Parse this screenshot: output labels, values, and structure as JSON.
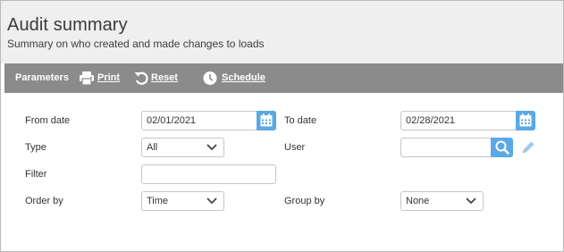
{
  "header": {
    "title": "Audit summary",
    "subtitle": "Summary on who created and made changes to loads"
  },
  "toolbar": {
    "label": "Parameters",
    "print": "Print",
    "reset": "Reset",
    "schedule": "Schedule"
  },
  "form": {
    "from_date": {
      "label": "From date",
      "value": "02/01/2021"
    },
    "to_date": {
      "label": "To date",
      "value": "02/28/2021"
    },
    "type": {
      "label": "Type",
      "value": "All"
    },
    "user": {
      "label": "User",
      "value": ""
    },
    "filter": {
      "label": "Filter",
      "value": ""
    },
    "order_by": {
      "label": "Order by",
      "value": "Time"
    },
    "group_by": {
      "label": "Group by",
      "value": "None"
    }
  },
  "colors": {
    "toolbar_bg": "#8b8b8b",
    "accent": "#5aa9e6",
    "header_bg": "#efefef"
  },
  "icons": [
    "printer-icon",
    "reset-icon",
    "clock-icon",
    "calendar-icon",
    "search-icon",
    "pencil-icon",
    "chevron-down-icon"
  ]
}
